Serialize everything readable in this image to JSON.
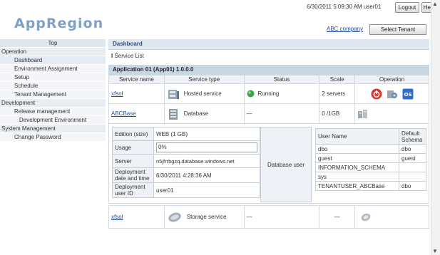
{
  "header": {
    "logo": "AppRegion",
    "datetime": "6/30/2011 5:09:30 AM user01",
    "logout_label": "Logout",
    "help_label": "Help",
    "company_link": "ABC company",
    "select_tenant_label": "Select Tenant"
  },
  "sidebar": {
    "top": "Top",
    "sections": [
      {
        "label": "Operation",
        "items": [
          "Dashboard",
          "Environment Assignment",
          "Setup",
          "Schedule",
          "Tenant Management"
        ]
      },
      {
        "label": "Development",
        "items": [
          "Release management",
          "Development Environment"
        ]
      },
      {
        "label": "System Management",
        "items": [
          "Change Password"
        ]
      }
    ],
    "active_item": "Dashboard"
  },
  "main": {
    "title": "Dashboard",
    "service_list_label": "Service List",
    "application_header": "Application 01 (App01)  1.0.0.0",
    "columns": [
      "Service name",
      "Service type",
      "Status",
      "Scale",
      "Operation"
    ],
    "services": [
      {
        "name": "xfsol",
        "type": "Hosted service",
        "status": "Running",
        "scale": "2 servers",
        "icon": "hosted-service-icon"
      },
      {
        "name": "ABCBase",
        "type": "Database",
        "status": "—",
        "scale": "0 /1GB",
        "icon": "database-icon"
      },
      {
        "name": "xfsol",
        "type": "Storage service",
        "status": "—",
        "scale": "—",
        "icon": "storage-icon"
      }
    ],
    "database_detail": {
      "rows": [
        {
          "label": "Edition (size)",
          "value": "WEB (1 GB)"
        },
        {
          "label": "Usage",
          "value": "0%"
        },
        {
          "label": "Server",
          "value": "n5jfrrbgzq.database.windows.net"
        },
        {
          "label": "Deployment date and time",
          "value": "6/30/2011 4:28:36 AM"
        },
        {
          "label": "Deployment user ID",
          "value": "user01"
        }
      ],
      "db_user_label": "Database user",
      "user_table": {
        "headers": [
          "User Name",
          "Default Schema"
        ],
        "rows": [
          [
            "dbo",
            "dbo"
          ],
          [
            "guest",
            "guest"
          ],
          [
            "INFORMATION_SCHEMA",
            ""
          ],
          [
            "sys",
            ""
          ],
          [
            "TENANTUSER_ABCBase",
            "dbo"
          ]
        ]
      }
    }
  },
  "colors": {
    "logo": "#7ea1c7",
    "header_band": "#dfe7f0",
    "app_header": "#c9d6e4",
    "running": "#3aa84a",
    "stop_button": "#d9342b",
    "os_button": "#2f6bd1"
  }
}
